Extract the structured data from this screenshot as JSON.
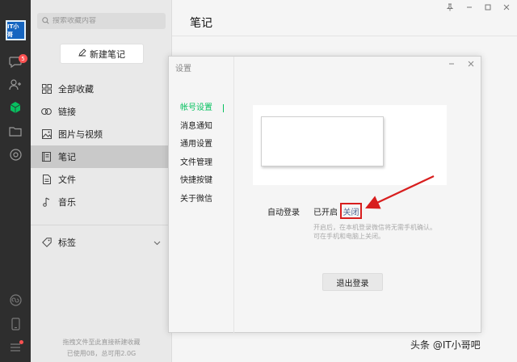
{
  "rail": {
    "avatar_text": "IT小哥",
    "chat_badge": "5"
  },
  "sidebar": {
    "search_placeholder": "搜索收藏内容",
    "new_note_label": "新建笔记",
    "items": [
      {
        "label": "全部收藏",
        "icon": "grid-icon"
      },
      {
        "label": "链接",
        "icon": "link-icon"
      },
      {
        "label": "图片与视频",
        "icon": "image-icon"
      },
      {
        "label": "笔记",
        "icon": "note-icon",
        "active": true
      },
      {
        "label": "文件",
        "icon": "file-icon"
      },
      {
        "label": "音乐",
        "icon": "music-icon"
      }
    ],
    "tags_label": "标签",
    "footer_line1": "拖拽文件至此直接新建收藏",
    "footer_line2": "已使用0B，总可用2.0G"
  },
  "main": {
    "title": "笔记"
  },
  "dialog": {
    "title": "设置",
    "menu": [
      "帐号设置",
      "消息通知",
      "通用设置",
      "文件管理",
      "快捷按键",
      "关于微信"
    ],
    "auto_login_label": "自动登录",
    "option_on": "已开启",
    "option_off": "关闭",
    "hint_line1": "开启后，在本机登录微信将无需手机确认。",
    "hint_line2": "可在手机和电脑上关闭。",
    "logout_label": "退出登录"
  },
  "watermark": "头条 @IT小哥吧",
  "colors": {
    "accent_green": "#07c160",
    "highlight_red": "#d81e1e",
    "link_blue": "#576b95"
  }
}
